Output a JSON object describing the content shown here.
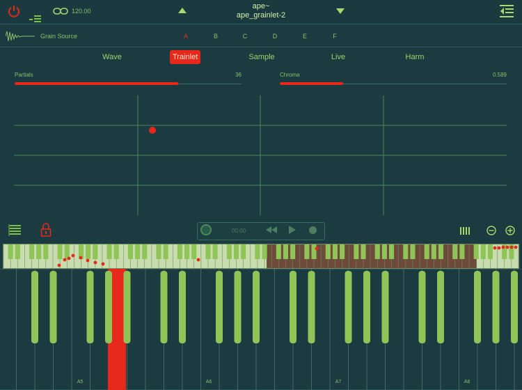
{
  "topbar": {
    "tempo": "120.00",
    "preset_line1": "ape~",
    "preset_line2": "ape_grainlet-2"
  },
  "grain": {
    "label": "Grain Source",
    "slots": [
      "A",
      "B",
      "C",
      "D",
      "E",
      "F"
    ],
    "active_slot": "A"
  },
  "tabs": [
    "Wave",
    "Trainlet",
    "Sample",
    "Live",
    "Harm"
  ],
  "active_tab": "Trainlet",
  "sliders": {
    "partials": {
      "label": "Partials",
      "value": "36",
      "fraction": 0.72
    },
    "chroma": {
      "label": "Chroma",
      "value": "0.589",
      "fraction": 0.28
    }
  },
  "transport": {
    "time": "00:00"
  },
  "keyboard": {
    "octave_labels": [
      "A5",
      "A6",
      "A7",
      "A8"
    ],
    "pressed_key": "C#6"
  },
  "colors": {
    "background": "#1b3b41",
    "accent": "#e8281a",
    "green": "#9fd36a",
    "key_green": "#8fc456"
  },
  "icons": [
    "power-icon",
    "level-icon",
    "link-icon",
    "menu-icon",
    "waveform-icon",
    "stack-icon",
    "lock-icon",
    "record-icon",
    "rewind-icon",
    "play-icon",
    "stop-icon",
    "bars-icon",
    "minus-icon",
    "plus-icon"
  ]
}
